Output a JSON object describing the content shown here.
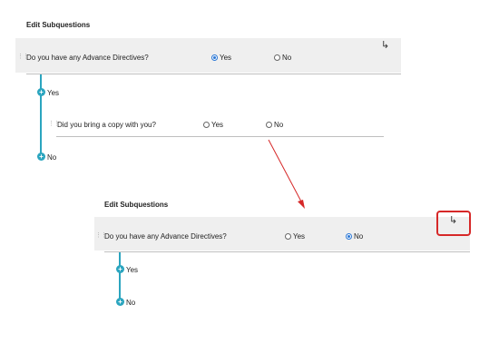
{
  "top": {
    "title": "Edit Subquestions",
    "question": "Do you have any Advance Directives?",
    "options": [
      {
        "label": "Yes",
        "selected": true
      },
      {
        "label": "No",
        "selected": false
      }
    ],
    "branches": [
      {
        "label": "Yes",
        "subquestion": {
          "text": "Did you bring a copy with you?",
          "options": [
            {
              "label": "Yes",
              "selected": false
            },
            {
              "label": "No",
              "selected": false
            }
          ]
        }
      },
      {
        "label": "No"
      }
    ],
    "subquestion_icon": "subdirectory-arrow-icon"
  },
  "bottom": {
    "title": "Edit Subquestions",
    "question": "Do you have any Advance Directives?",
    "options": [
      {
        "label": "Yes",
        "selected": false
      },
      {
        "label": "No",
        "selected": true
      }
    ],
    "branches": [
      {
        "label": "Yes"
      },
      {
        "label": "No"
      }
    ],
    "subquestion_icon": "subdirectory-arrow-icon"
  },
  "colors": {
    "annotation": "#d62828",
    "accent": "#2ba5bf",
    "selected": "#2a77d6"
  }
}
